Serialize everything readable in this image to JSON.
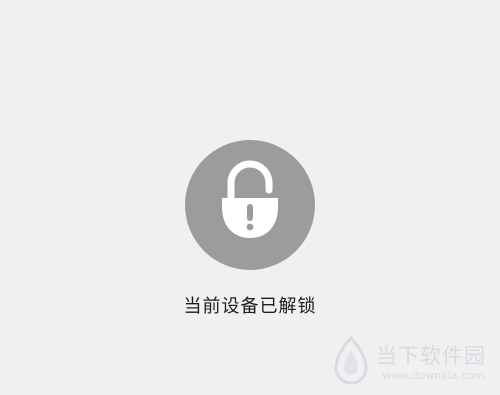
{
  "status": {
    "icon": "unlocked-padlock-icon",
    "text": "当前设备已解锁"
  },
  "watermark": {
    "logo": "downxia-logo",
    "title": "当下软件园",
    "url": "www.downxia.com"
  },
  "colors": {
    "background": "#f0f0f2",
    "badge": "#9a9c9e",
    "text": "#1d1d1f"
  }
}
